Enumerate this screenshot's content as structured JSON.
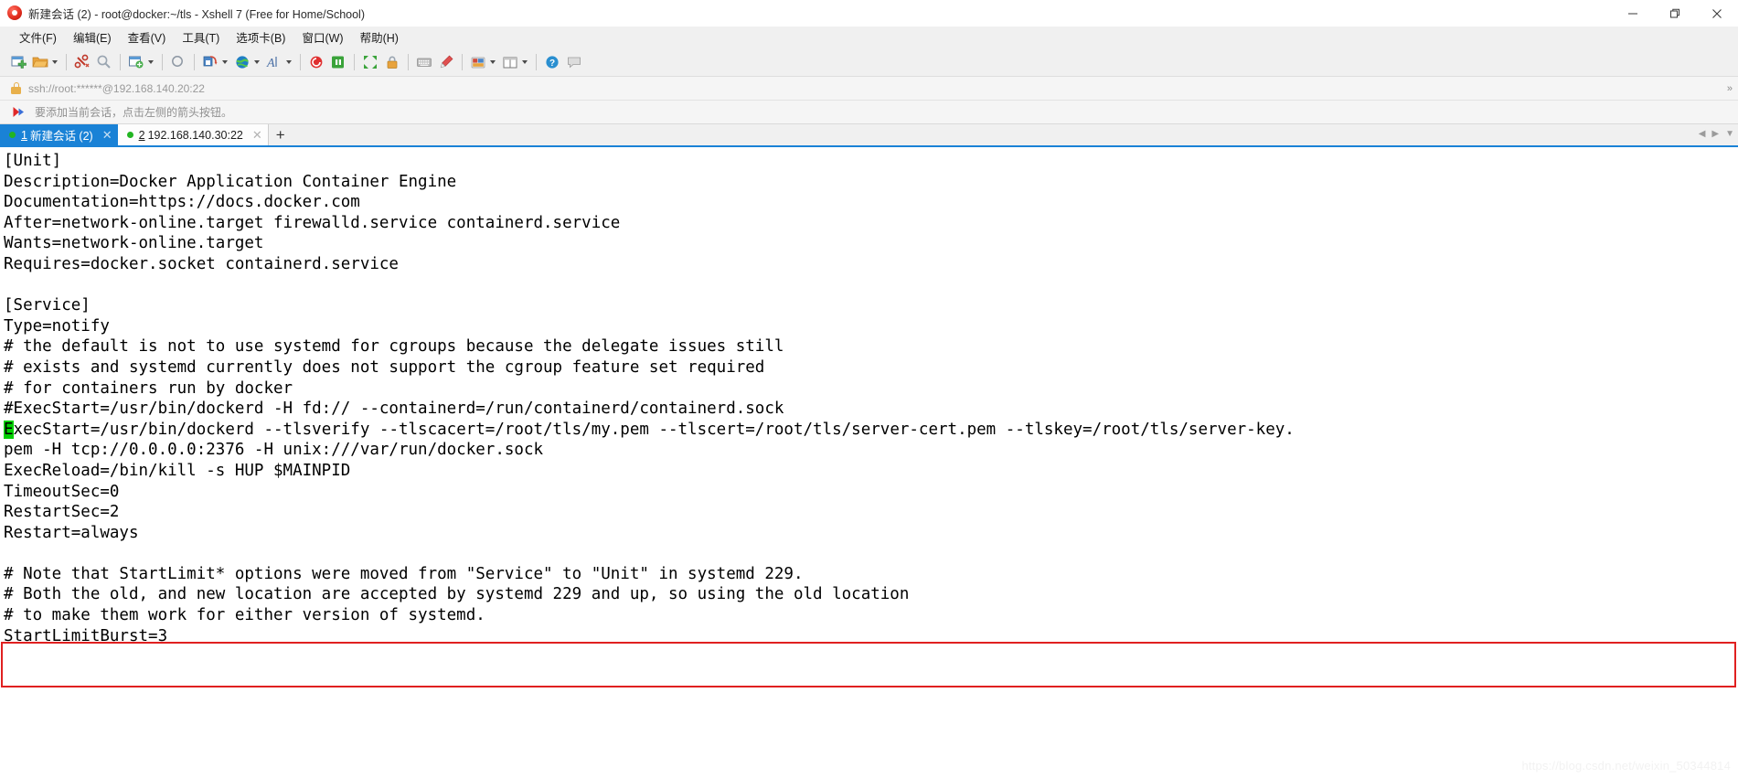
{
  "window": {
    "title": "新建会话 (2) - root@docker:~/tls - Xshell 7 (Free for Home/School)",
    "logo_icon": "xshell-logo-icon",
    "minimize_icon": "minimize-icon",
    "maximize_icon": "maximize-icon",
    "close_icon": "close-icon"
  },
  "menubar": {
    "items": [
      {
        "label": "文件(F)",
        "name": "menu-file"
      },
      {
        "label": "编辑(E)",
        "name": "menu-edit"
      },
      {
        "label": "查看(V)",
        "name": "menu-view"
      },
      {
        "label": "工具(T)",
        "name": "menu-tools"
      },
      {
        "label": "选项卡(B)",
        "name": "menu-tabs"
      },
      {
        "label": "窗口(W)",
        "name": "menu-window"
      },
      {
        "label": "帮助(H)",
        "name": "menu-help"
      }
    ]
  },
  "toolbar": {
    "items": [
      {
        "name": "new-session-icon",
        "caret": false
      },
      {
        "name": "open-folder-icon",
        "caret": true
      },
      {
        "name": "separator",
        "caret": false
      },
      {
        "name": "disconnect-icon",
        "caret": false
      },
      {
        "name": "reconnect-icon",
        "caret": false
      },
      {
        "name": "separator",
        "caret": false
      },
      {
        "name": "new-file-transfer-icon",
        "caret": true
      },
      {
        "name": "separator",
        "caret": false
      },
      {
        "name": "find-icon",
        "caret": false
      },
      {
        "name": "separator",
        "caret": false
      },
      {
        "name": "paste-icon",
        "caret": true
      },
      {
        "name": "globe-icon",
        "caret": true
      },
      {
        "name": "font-icon",
        "caret": true
      },
      {
        "name": "separator",
        "caret": false
      },
      {
        "name": "record-icon",
        "caret": false
      },
      {
        "name": "log-icon",
        "caret": false
      },
      {
        "name": "separator",
        "caret": false
      },
      {
        "name": "fullscreen-icon",
        "caret": false
      },
      {
        "name": "lock-icon",
        "caret": false
      },
      {
        "name": "separator",
        "caret": false
      },
      {
        "name": "keyboard-icon",
        "caret": false
      },
      {
        "name": "highlight-icon",
        "caret": false
      },
      {
        "name": "separator",
        "caret": false
      },
      {
        "name": "color-scheme-icon",
        "caret": true
      },
      {
        "name": "layout-icon",
        "caret": true
      },
      {
        "name": "separator",
        "caret": false
      },
      {
        "name": "help-icon",
        "caret": false
      },
      {
        "name": "comment-icon",
        "caret": false
      }
    ]
  },
  "address_bar": {
    "lock_icon": "lock-icon",
    "value": "ssh://root:******@192.168.140.20:22",
    "chevrons": "»"
  },
  "notice_bar": {
    "arrow_icon": "red-arrow-icon",
    "text": "要添加当前会话，点击左侧的箭头按钮。"
  },
  "tabs": {
    "items": [
      {
        "num": "1",
        "label": "新建会话 (2)",
        "active": true,
        "status": "connected",
        "close_icon": "close-icon"
      },
      {
        "num": "2",
        "label": "192.168.140.30:22",
        "active": false,
        "status": "connected",
        "close_icon": "close-icon"
      }
    ],
    "add_label": "+",
    "scroll_left_icon": "chevron-left-icon",
    "scroll_right_icon": "chevron-right-icon",
    "menu_icon": "chevron-down-icon"
  },
  "terminal": {
    "cursor_char": "E",
    "lines": [
      {
        "text": "[Unit]"
      },
      {
        "text": "Description=Docker Application Container Engine"
      },
      {
        "text": "Documentation=https://docs.docker.com"
      },
      {
        "text": "After=network-online.target firewalld.service containerd.service"
      },
      {
        "text": "Wants=network-online.target"
      },
      {
        "text": "Requires=docker.socket containerd.service"
      },
      {
        "text": ""
      },
      {
        "text": "[Service]"
      },
      {
        "text": "Type=notify"
      },
      {
        "text": "# the default is not to use systemd for cgroups because the delegate issues still"
      },
      {
        "text": "# exists and systemd currently does not support the cgroup feature set required"
      },
      {
        "text": "# for containers run by docker"
      },
      {
        "text": "#ExecStart=/usr/bin/dockerd -H fd:// --containerd=/run/containerd/containerd.sock"
      },
      {
        "text": "xecStart=/usr/bin/dockerd --tlsverify --tlscacert=/root/tls/my.pem --tlscert=/root/tls/server-cert.pem --tlskey=/root/tls/server-key.",
        "cursor": true
      },
      {
        "text": "pem -H tcp://0.0.0.0:2376 -H unix:///var/run/docker.sock"
      },
      {
        "text": "ExecReload=/bin/kill -s HUP $MAINPID"
      },
      {
        "text": "TimeoutSec=0"
      },
      {
        "text": "RestartSec=2"
      },
      {
        "text": "Restart=always"
      },
      {
        "text": ""
      },
      {
        "text": "# Note that StartLimit* options were moved from \"Service\" to \"Unit\" in systemd 229."
      },
      {
        "text": "# Both the old, and new location are accepted by systemd 229 and up, so using the old location"
      },
      {
        "text": "# to make them work for either version of systemd."
      },
      {
        "text": "StartLimitBurst=3"
      }
    ],
    "watermark": "https://blog.csdn.net/weixin_50344814"
  },
  "colors": {
    "accent": "#1a82d6",
    "highlight_border": "#e02020",
    "cursor": "#00d000",
    "status_dot": "#22b522"
  }
}
